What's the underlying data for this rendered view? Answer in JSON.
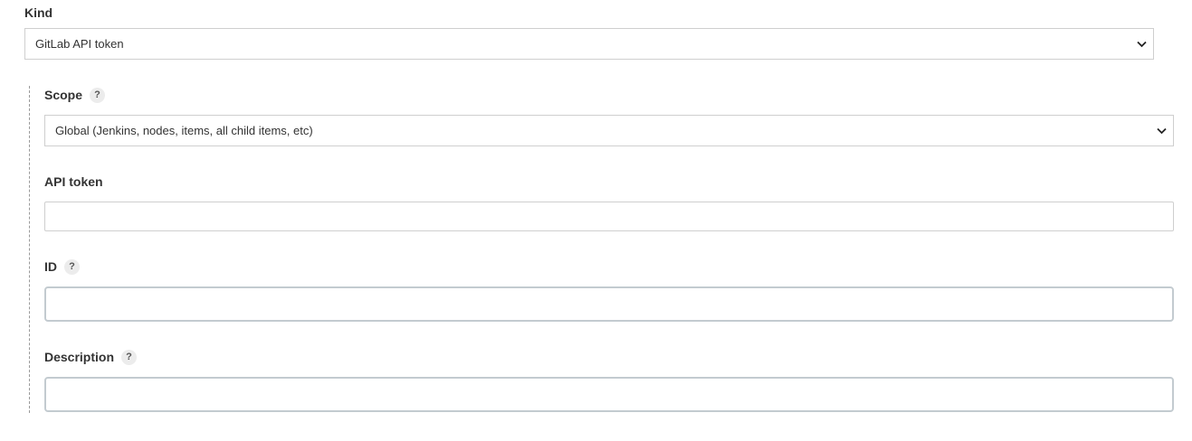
{
  "kind": {
    "label": "Kind",
    "selected": "GitLab API token"
  },
  "scope": {
    "label": "Scope",
    "help": "?",
    "selected": "Global (Jenkins, nodes, items, all child items, etc)"
  },
  "api_token": {
    "label": "API token",
    "value": ""
  },
  "id_field": {
    "label": "ID",
    "help": "?",
    "value": ""
  },
  "description": {
    "label": "Description",
    "help": "?",
    "value": ""
  },
  "icons": {
    "chevron": "chevron-down-icon",
    "help": "help-icon"
  }
}
